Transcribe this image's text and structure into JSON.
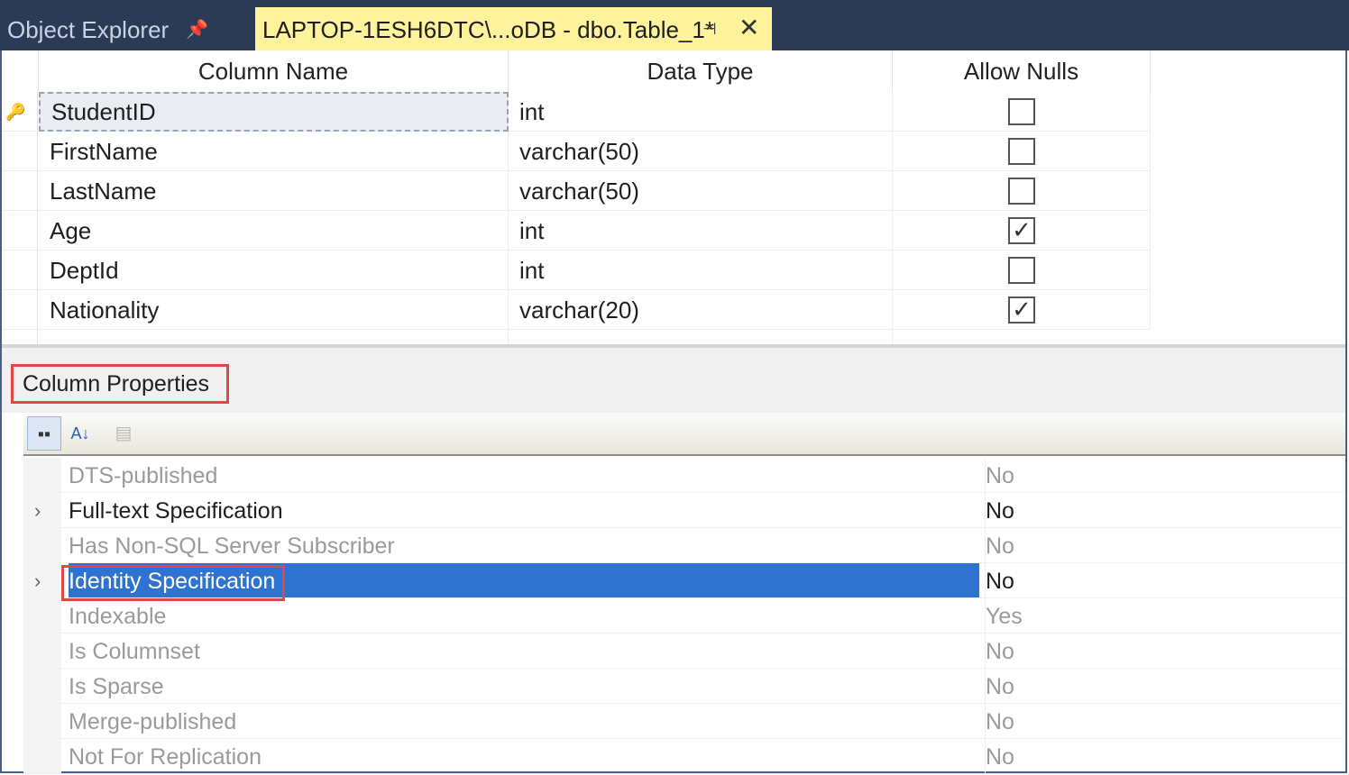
{
  "tabs": {
    "object_explorer": "Object Explorer",
    "object_explorer_pin": "📌",
    "document": "LAPTOP-1ESH6DTC\\...oDB - dbo.Table_1*",
    "document_pin": "⊣",
    "document_close": "✕"
  },
  "grid": {
    "headers": [
      "Column Name",
      "Data Type",
      "Allow Nulls"
    ],
    "rows": [
      {
        "name": "StudentID",
        "type": "int",
        "allow_nulls": false,
        "key": true
      },
      {
        "name": "FirstName",
        "type": "varchar(50)",
        "allow_nulls": false
      },
      {
        "name": "LastName",
        "type": "varchar(50)",
        "allow_nulls": false
      },
      {
        "name": "Age",
        "type": "int",
        "allow_nulls": true
      },
      {
        "name": "DeptId",
        "type": "int",
        "allow_nulls": false
      },
      {
        "name": "Nationality",
        "type": "varchar(20)",
        "allow_nulls": true
      }
    ],
    "key_icon": "🔑",
    "check_mark": "✓"
  },
  "column_properties": {
    "title": "Column Properties",
    "toolbar": {
      "categorized": "▪▪",
      "alphabetical": "A↓",
      "property_pages": "▤"
    },
    "rows": [
      {
        "name": "DTS-published",
        "value": "No"
      },
      {
        "name": "Full-text Specification",
        "value": "No",
        "expandable": true
      },
      {
        "name": "Has Non-SQL Server Subscriber",
        "value": "No"
      },
      {
        "name": "Identity Specification",
        "value": "No",
        "expandable": true
      },
      {
        "name": "Indexable",
        "value": "Yes"
      },
      {
        "name": "Is Columnset",
        "value": "No"
      },
      {
        "name": "Is Sparse",
        "value": "No"
      },
      {
        "name": "Merge-published",
        "value": "No"
      },
      {
        "name": "Not For Replication",
        "value": "No"
      }
    ],
    "expand_glyph": "›"
  },
  "colors": {
    "tab_bar": "#2b3a55",
    "active_tab": "#fff29d",
    "selection": "#2e73cf",
    "annotation": "#e04848"
  }
}
